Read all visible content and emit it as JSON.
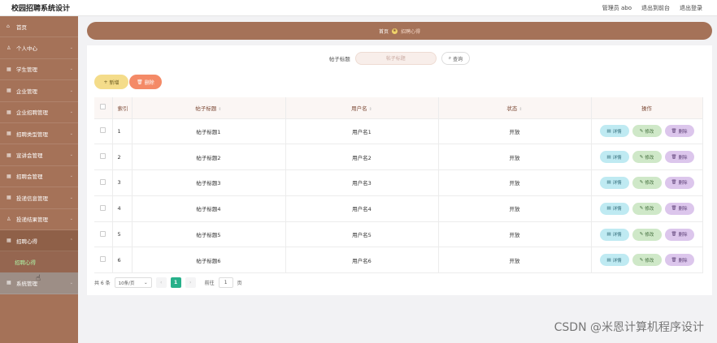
{
  "header": {
    "title": "校园招聘系统设计",
    "links": [
      "管理员 abo",
      "退出到前台",
      "退出登录"
    ]
  },
  "sidebar": {
    "items": [
      {
        "label": "首页",
        "icon": "home-icon"
      },
      {
        "label": "个人中心",
        "icon": "user-icon"
      },
      {
        "label": "学生管理",
        "icon": "grid-icon"
      },
      {
        "label": "企业管理",
        "icon": "grid-icon"
      },
      {
        "label": "企业招聘管理",
        "icon": "grid-icon"
      },
      {
        "label": "招聘类型管理",
        "icon": "grid-icon"
      },
      {
        "label": "宣讲会管理",
        "icon": "grid-icon"
      },
      {
        "label": "招聘会管理",
        "icon": "grid-icon"
      },
      {
        "label": "投递信息管理",
        "icon": "grid-icon"
      },
      {
        "label": "投递结果管理",
        "icon": "user-icon"
      },
      {
        "label": "招聘心得",
        "icon": "grid-icon"
      }
    ],
    "submenu": "招聘心得",
    "last_item": "系统管理"
  },
  "breadcrumb": {
    "home": "首页",
    "current": "招聘心得"
  },
  "search": {
    "label": "帖子标题",
    "placeholder": "帖子标题",
    "button": "查询"
  },
  "actions": {
    "add": "新增",
    "delete": "删除"
  },
  "table": {
    "columns": [
      "索引",
      "帖子标题",
      "用户名",
      "状态",
      "操作"
    ],
    "rows": [
      {
        "index": "1",
        "title": "帖子标题1",
        "user": "用户名1",
        "status": "开放"
      },
      {
        "index": "2",
        "title": "帖子标题2",
        "user": "用户名2",
        "status": "开放"
      },
      {
        "index": "3",
        "title": "帖子标题3",
        "user": "用户名3",
        "status": "开放"
      },
      {
        "index": "4",
        "title": "帖子标题4",
        "user": "用户名4",
        "status": "开放"
      },
      {
        "index": "5",
        "title": "帖子标题5",
        "user": "用户名5",
        "status": "开放"
      },
      {
        "index": "6",
        "title": "帖子标题6",
        "user": "用户名6",
        "status": "开放"
      }
    ],
    "op_labels": {
      "detail": "详情",
      "edit": "修改",
      "delete": "删除"
    }
  },
  "pagination": {
    "total": "共 6 条",
    "page_size": "10条/页",
    "current_page": "1",
    "goto_label": "前往",
    "goto_value": "1",
    "page_suffix": "页"
  },
  "watermark": "CSDN @米恩计算机程序设计"
}
